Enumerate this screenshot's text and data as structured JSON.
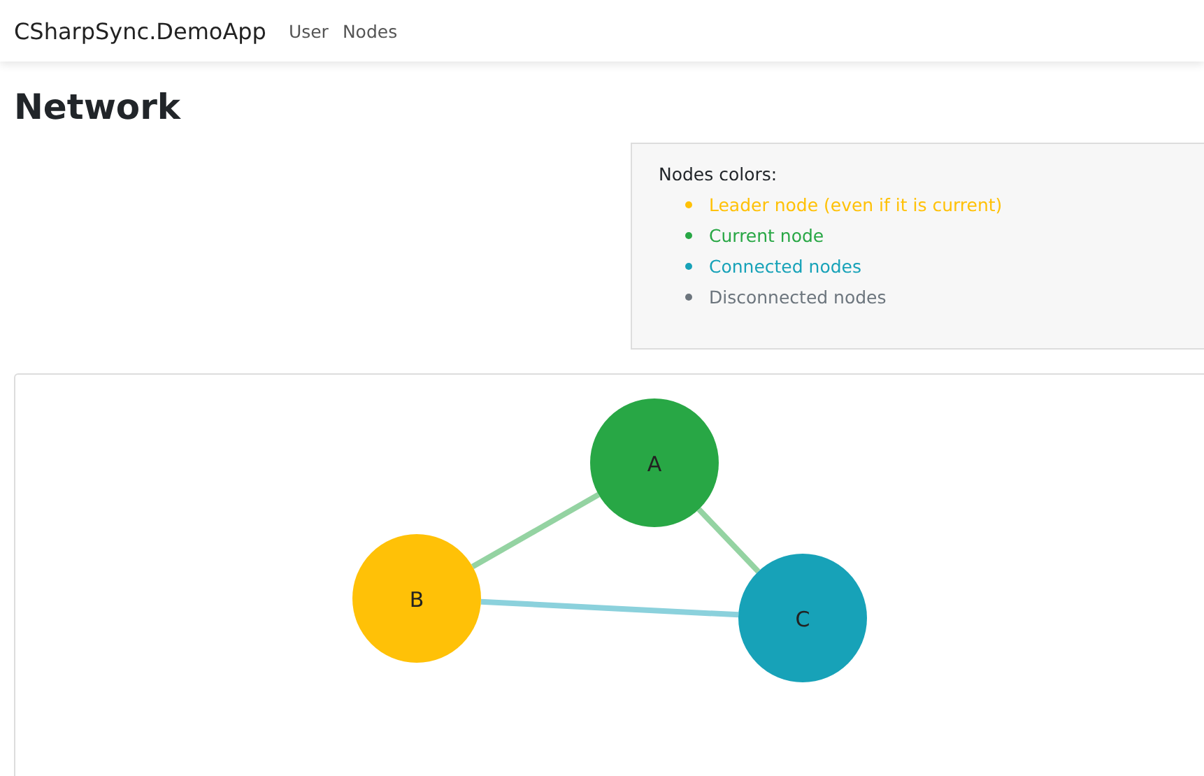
{
  "navbar": {
    "brand": "CSharpSync.DemoApp",
    "links": [
      "User",
      "Nodes"
    ]
  },
  "page_title": "Network",
  "legend": {
    "title": "Nodes colors:",
    "items": [
      {
        "label": "Leader node (even if it is current)",
        "color": "#ffc107"
      },
      {
        "label": "Current node",
        "color": "#28a745"
      },
      {
        "label": "Connected nodes",
        "color": "#17a2b8"
      },
      {
        "label": "Disconnected nodes",
        "color": "#6c757d"
      }
    ]
  },
  "graph": {
    "nodes": [
      {
        "label": "A",
        "color": "#28a745"
      },
      {
        "label": "B",
        "color": "#ffc107"
      },
      {
        "label": "C",
        "color": "#17a2b8"
      }
    ],
    "edges": [
      {
        "color": "#94d3a2"
      },
      {
        "color": "#94d3a2"
      },
      {
        "color": "#8bd1dc"
      }
    ]
  }
}
